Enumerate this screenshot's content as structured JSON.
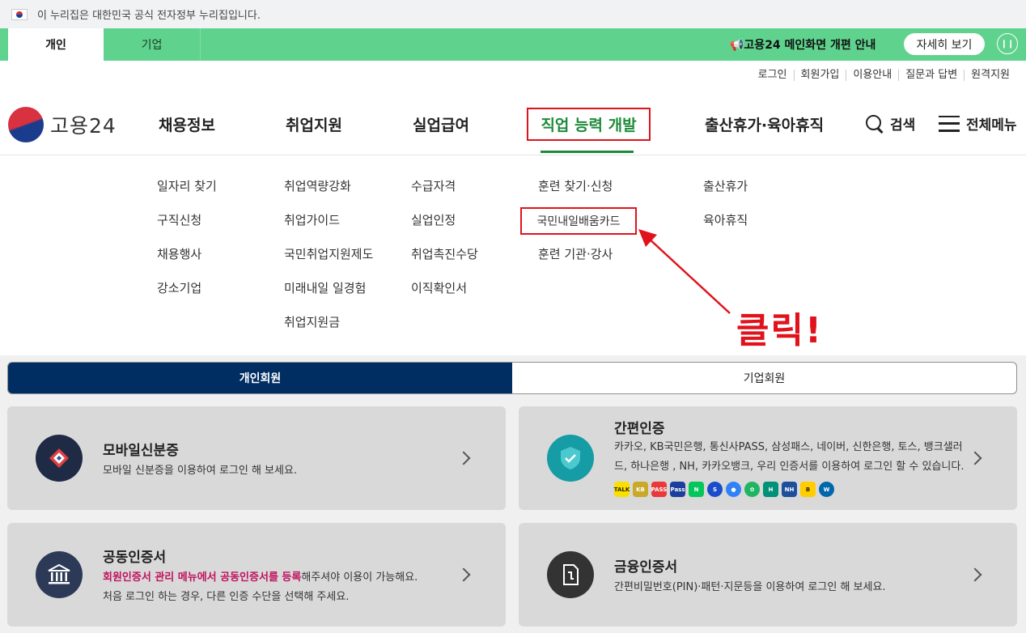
{
  "gov_banner": {
    "text": "이 누리집은 대한민국 공식 전자정부 누리집입니다."
  },
  "top_tabs": [
    {
      "label": "개인"
    },
    {
      "label": "기업"
    }
  ],
  "notice": {
    "text": "📢고용24 메인화면 개편 안내",
    "button": "자세히 보기",
    "pause": "❙❙"
  },
  "util_links": [
    "로그인",
    "회원가입",
    "이용안내",
    "질문과 답변",
    "원격지원"
  ],
  "logo": {
    "text": "고용24"
  },
  "nav": [
    "채용정보",
    "취업지원",
    "실업급여",
    "직업 능력 개발",
    "출산휴가·육아휴직"
  ],
  "search_label": "검색",
  "all_menu_label": "전체메뉴",
  "submenu": {
    "col1": [
      "일자리 찾기",
      "구직신청",
      "채용행사",
      "강소기업"
    ],
    "col2": [
      "취업역량강화",
      "취업가이드",
      "국민취업지원제도",
      "미래내일 일경험",
      "취업지원금"
    ],
    "col3": [
      "수급자격",
      "실업인정",
      "취업촉진수당",
      "이직확인서"
    ],
    "col4": [
      "훈련 찾기·신청",
      "국민내일배움카드",
      "훈련 기관·강사"
    ],
    "col5": [
      "출산휴가",
      "육아휴직"
    ]
  },
  "annotation": {
    "text": "클릭!"
  },
  "member_tabs": [
    "개인회원",
    "기업회원"
  ],
  "cards": {
    "mobile_id": {
      "title": "모바일신분증",
      "desc": "모바일 신분증을 이용하여 로그인 해 보세요."
    },
    "simple_auth": {
      "title": "간편인증",
      "desc1": "카카오, KB국민은행, 통신사PASS, 삼성패스, 네이버, 신한은행, 토스, 뱅크샐러",
      "desc2": "드, 하나은행 , NH, 카카오뱅크, 우리 인증서를 이용하여 로그인 할 수 있습니다."
    },
    "joint_cert": {
      "title": "공동인증서",
      "desc1_highlight": "회원인증서 관리 메뉴에서 공동인증서를 등록",
      "desc1_rest": "해주셔야 이용이 가능해요.",
      "desc2": "처음 로그인 하는 경우, 다른 인증 수단을 선택해 주세요."
    },
    "finance_cert": {
      "title": "금융인증서",
      "desc": "간편비밀번호(PIN)·패턴·지문등을 이용하여 로그인 해 보세요."
    }
  },
  "brand_icons": [
    {
      "name": "kakao",
      "color": "#f9e000",
      "label": "TALK"
    },
    {
      "name": "kb",
      "color": "#c9a82a",
      "label": "KB"
    },
    {
      "name": "pass",
      "color": "#e83a3a",
      "label": "PASS"
    },
    {
      "name": "samsung-pass",
      "color": "#1b3f9c",
      "label": "Pass"
    },
    {
      "name": "naver",
      "color": "#03c75a",
      "label": "N"
    },
    {
      "name": "shinhan",
      "color": "#1a4dc9",
      "label": "S"
    },
    {
      "name": "toss",
      "color": "#3182f6",
      "label": "●"
    },
    {
      "name": "banksalad",
      "color": "#1fb563",
      "label": "✿"
    },
    {
      "name": "hana",
      "color": "#009178",
      "label": "H"
    },
    {
      "name": "nh",
      "color": "#1f4e9c",
      "label": "NH"
    },
    {
      "name": "kakaobank",
      "color": "#ffcd00",
      "label": "B"
    },
    {
      "name": "woori",
      "color": "#0067ac",
      "label": "W"
    }
  ]
}
